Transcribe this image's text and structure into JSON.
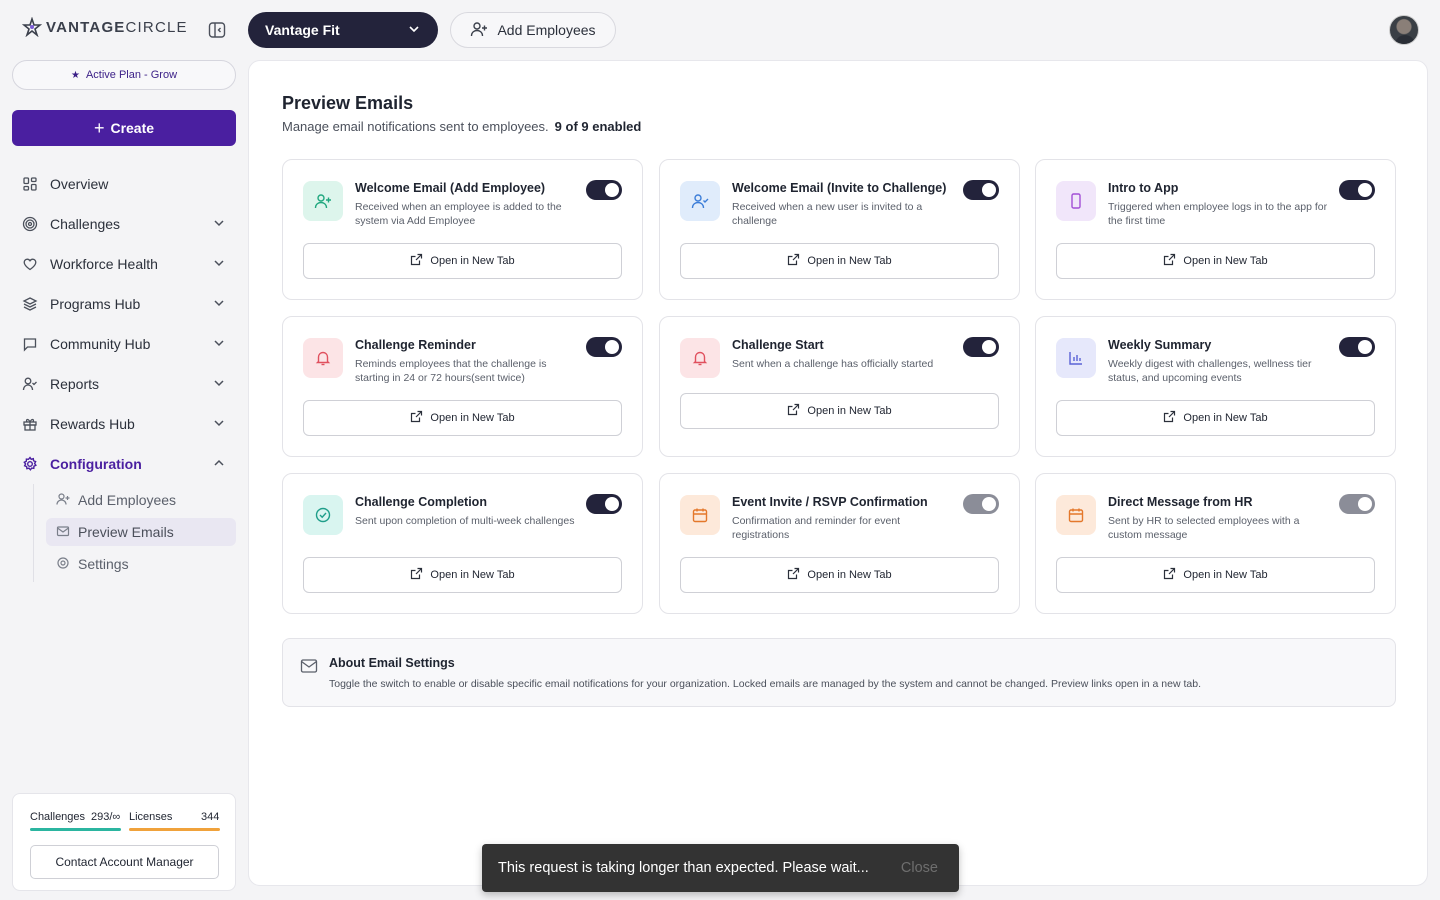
{
  "brand": {
    "name_bold": "VANTAGE",
    "name_thin": "CIRCLE"
  },
  "sidebar": {
    "plan": "Active Plan - Grow",
    "create_label": "Create",
    "items": [
      {
        "label": "Overview",
        "icon": "grid-icon"
      },
      {
        "label": "Challenges",
        "icon": "target-icon"
      },
      {
        "label": "Workforce Health",
        "icon": "heart-icon"
      },
      {
        "label": "Programs Hub",
        "icon": "layers-icon"
      },
      {
        "label": "Community Hub",
        "icon": "chat-icon"
      },
      {
        "label": "Reports",
        "icon": "user-check-icon"
      },
      {
        "label": "Rewards Hub",
        "icon": "gift-icon"
      },
      {
        "label": "Configuration",
        "icon": "gear-icon"
      }
    ],
    "sub_items": [
      {
        "label": "Add Employees"
      },
      {
        "label": "Preview Emails"
      },
      {
        "label": "Settings"
      }
    ],
    "usage": {
      "challenges_label": "Challenges",
      "challenges_value": "293/∞",
      "licenses_label": "Licenses",
      "licenses_value": "344",
      "challenges_color": "#2bb5a0",
      "licenses_color": "#f0a23b"
    },
    "contact_label": "Contact Account Manager"
  },
  "topbar": {
    "app_select": "Vantage Fit",
    "add_employees": "Add Employees"
  },
  "main": {
    "title": "Preview Emails",
    "subtitle": "Manage email notifications sent to employees.",
    "enabled_count": "9 of 9 enabled",
    "open_label": "Open in New Tab",
    "cards": [
      {
        "title": "Welcome Email (Add Employee)",
        "desc": "Received when an employee is added to the system via Add Employee",
        "icon": "user-plus-icon",
        "enabled": true,
        "locked": false
      },
      {
        "title": "Welcome Email (Invite to Challenge)",
        "desc": "Received when a new user is invited to a challenge",
        "icon": "user-check-icon",
        "enabled": true,
        "locked": false
      },
      {
        "title": "Intro to App",
        "desc": "Triggered when employee logs in to the app for the first time",
        "icon": "phone-icon",
        "enabled": true,
        "locked": false
      },
      {
        "title": "Challenge Reminder",
        "desc": "Reminds employees that the challenge is starting in 24 or 72 hours(sent twice)",
        "icon": "bell-icon",
        "enabled": true,
        "locked": false
      },
      {
        "title": "Challenge Start",
        "desc": "Sent when a challenge has officially started",
        "icon": "bell-icon",
        "enabled": true,
        "locked": false
      },
      {
        "title": "Weekly Summary",
        "desc": "Weekly digest with challenges, wellness tier status, and upcoming events",
        "icon": "bar-chart-icon",
        "enabled": true,
        "locked": false
      },
      {
        "title": "Challenge Completion",
        "desc": "Sent upon completion of multi-week challenges",
        "icon": "check-circle-icon",
        "enabled": true,
        "locked": false
      },
      {
        "title": "Event Invite / RSVP Confirmation",
        "desc": "Confirmation and reminder for event registrations",
        "icon": "calendar-icon",
        "enabled": true,
        "locked": true
      },
      {
        "title": "Direct Message from HR",
        "desc": "Sent by HR to selected employees with a custom message",
        "icon": "calendar-icon",
        "enabled": true,
        "locked": true
      }
    ],
    "about": {
      "title": "About Email Settings",
      "text": "Toggle the switch to enable or disable specific email notifications for your organization. Locked emails are managed by the system and cannot be changed. Preview links open in a new tab."
    }
  },
  "toast": {
    "message": "This request is taking longer than expected. Please wait...",
    "close_label": "Close"
  }
}
